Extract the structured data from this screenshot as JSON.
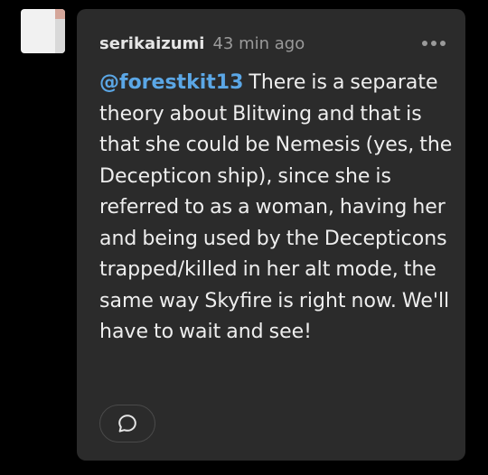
{
  "avatar": {
    "colors": {
      "base": "#f1f1f1",
      "fold": "#d9d9d9",
      "corner": "#d4a69a"
    }
  },
  "post": {
    "username": "serikaizumi",
    "timestamp": "43 min ago",
    "mention": "@forestkit13",
    "text": "There is a separate theory about Blitwing and that is that she could be Nemesis (yes, the Decepticon ship), since she is referred to as a woman, having her and being used by the Decepticons trapped/killed in her alt mode, the same way Skyfire is right now. We'll have to wait and see!"
  },
  "icons": {
    "more": "more-horizontal-icon",
    "reply": "speech-bubble-icon"
  },
  "colors": {
    "background": "#000000",
    "card": "#2b2b2b",
    "mention": "#5ba7e6",
    "text": "#eeeeee",
    "muted": "#9a9a9a"
  }
}
